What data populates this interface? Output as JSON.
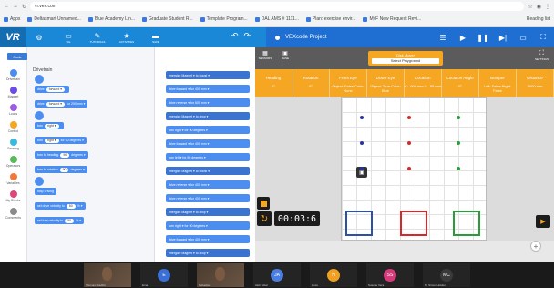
{
  "browser": {
    "url": "vr.vex.com",
    "bookmarks": [
      "Apps",
      "Deltasmart Unnamed...",
      "Blue Academy Lin...",
      "Graduate Student R...",
      "Template Program...",
      "DAL AMS # 1111...",
      "Plan: exercise envir...",
      "MyF New Request Revi..."
    ],
    "reading_list": "Reading list"
  },
  "app": {
    "logo": "VR",
    "toolbar": [
      {
        "icon": "gear-icon",
        "glyph": "⚙",
        "label": ""
      },
      {
        "icon": "file-icon",
        "glyph": "▭",
        "label": "File"
      },
      {
        "icon": "tutorials-icon",
        "glyph": "✎",
        "label": "TUTORIALS"
      },
      {
        "icon": "activities-icon",
        "glyph": "★",
        "label": "ACTIVITIES"
      },
      {
        "icon": "save-icon",
        "glyph": "▬",
        "label": "SAVE"
      }
    ],
    "undo_glyph": "↶",
    "redo_glyph": "↷",
    "project_title": "VEXcode Project",
    "right_buttons": [
      "☰",
      "▶",
      "❚❚",
      "▶|",
      "▭",
      "⛶"
    ]
  },
  "palette": {
    "tab_label": "Code",
    "categories": [
      {
        "name": "Drivetrain",
        "color": "#4c8ef0"
      },
      {
        "name": "Magnet",
        "color": "#6b4ce6"
      },
      {
        "name": "Looks",
        "color": "#9b5de5"
      },
      {
        "name": "Control",
        "color": "#f5a623"
      },
      {
        "name": "Sensing",
        "color": "#3db8e0"
      },
      {
        "name": "Operators",
        "color": "#5cb85c"
      },
      {
        "name": "Variables",
        "color": "#f0793a"
      },
      {
        "name": "My Blocks",
        "color": "#e0457b"
      },
      {
        "name": "Comments",
        "color": "#8a8a8a"
      }
    ],
    "section_title": "Drivetrain",
    "blocks": [
      {
        "text": "drive",
        "opt": "forward ▾",
        "suffix": ""
      },
      {
        "text": "drive",
        "opt": "forward ▾",
        "suffix": "for 200 mm ▾"
      },
      {
        "text": "turn",
        "opt": "right ▾",
        "suffix": ""
      },
      {
        "text": "turn",
        "opt": "right ▾",
        "suffix": "for 90 degrees ▾"
      },
      {
        "text": "turn to heading",
        "opt": "90",
        "suffix": "degrees ▾"
      },
      {
        "text": "turn to rotation",
        "opt": "90",
        "suffix": "degrees ▾"
      },
      {
        "text": "stop driving",
        "opt": "",
        "suffix": ""
      },
      {
        "text": "set drive velocity to",
        "opt": "50",
        "suffix": "% ▾"
      },
      {
        "text": "set turn velocity to",
        "opt": "50",
        "suffix": "% ▾"
      }
    ]
  },
  "workspace": {
    "blocks": [
      "energize Magnet ▾ to boost ▾",
      "drive forward ▾ for 400 mm ▾",
      "drive reverse ▾ for 600 mm ▾",
      "energize Magnet ▾ to drop ▾",
      "turn right ▾ for 90 degrees ▾",
      "drive forward ▾ for 400 mm ▾",
      "turn left ▾ for 90 degrees ▾",
      "energize Magnet ▾ to boost ▾",
      "drive reverse ▾ for 400 mm ▾",
      "drive reverse ▾ for 400 mm ▾",
      "energize Magnet ▾ to drop ▾",
      "turn right ▾ for 90 degrees ▾",
      "drive forward ▾ for 400 mm ▾",
      "energize Magnet ▾ to drop ▾"
    ]
  },
  "playground": {
    "icons": [
      {
        "glyph": "▦",
        "label": "SENSORS"
      },
      {
        "glyph": "▣",
        "label": "BASE"
      }
    ],
    "select_label": "Disk Mover",
    "select_value": "Select Playground",
    "right_glyph": "⛶",
    "right_label": "SETTINGS",
    "sensors": [
      {
        "header": "Heading",
        "value": "0°"
      },
      {
        "header": "Rotation",
        "value": "0°"
      },
      {
        "header": "Front Eye",
        "value": "Object: False Color: None"
      },
      {
        "header": "Down Eye",
        "value": "Object: True Color: Blue"
      },
      {
        "header": "Location",
        "value": "X: -900 mm Y: -85 mm"
      },
      {
        "header": "Location Angle",
        "value": "0°"
      },
      {
        "header": "Bumper",
        "value": "Left: False Right: False"
      },
      {
        "header": "Distance",
        "value": "3000 mm"
      }
    ],
    "timer": "00:03:6",
    "dot_colors": {
      "blue": "#2233aa",
      "red": "#d62828",
      "green": "#2a9d3a"
    },
    "zone_colors": [
      "#2d4fa8",
      "#d62828",
      "#2a9d3a"
    ]
  },
  "meeting": {
    "participants": [
      {
        "type": "video",
        "name": "Thomas Bradbin"
      },
      {
        "type": "avatar",
        "initials": "E",
        "name": "Ema",
        "color": "#3a6fd8"
      },
      {
        "type": "video",
        "name": "Sebastien"
      },
      {
        "type": "avatar",
        "initials": "JA",
        "name": "Aleli Tobar",
        "color": "#4a7ee0"
      },
      {
        "type": "avatar",
        "initials": "H",
        "name": "Hoss",
        "color": "#f0a020"
      },
      {
        "type": "avatar",
        "initials": "SS",
        "name": "Susane Vera",
        "color": "#d63a7a"
      },
      {
        "type": "avatar",
        "initials": "MC",
        "name": "M. Simon Holden",
        "color": "#3a3a3a"
      }
    ]
  }
}
